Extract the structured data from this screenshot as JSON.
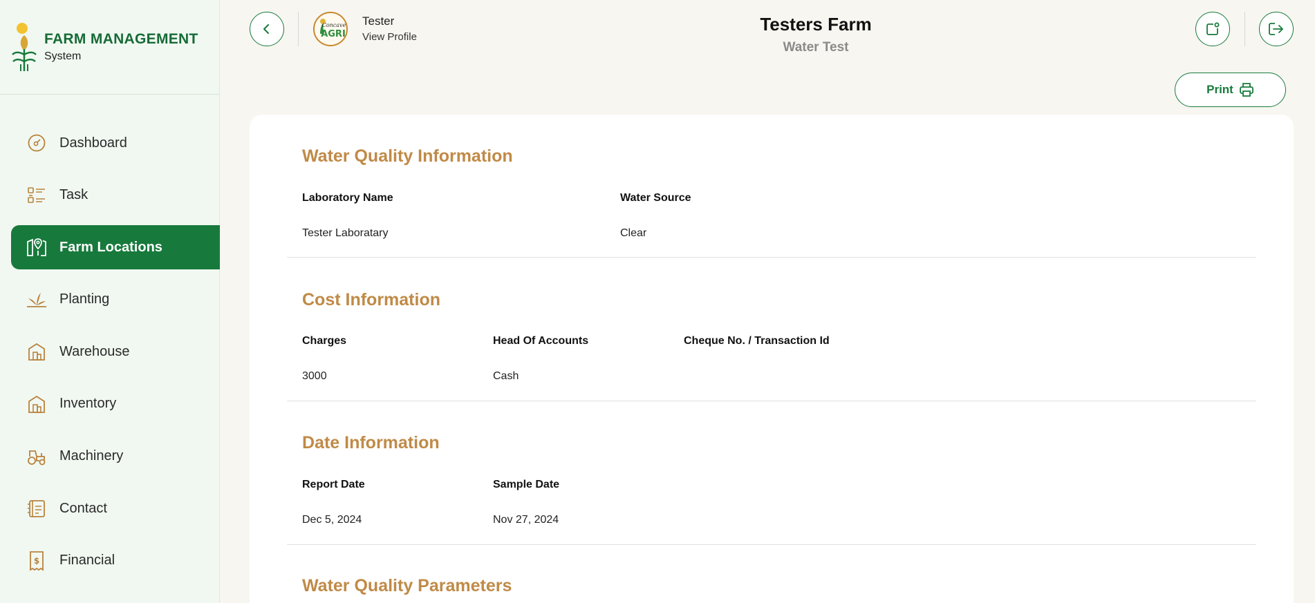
{
  "brand": {
    "title": "FARM MANAGEMENT",
    "subtitle": "System"
  },
  "sidebar": {
    "items": [
      {
        "label": "Dashboard",
        "icon": "dashboard-gauge-icon",
        "active": false
      },
      {
        "label": "Task",
        "icon": "task-list-icon",
        "active": false
      },
      {
        "label": "Farm Locations",
        "icon": "map-pin-icon",
        "active": true
      },
      {
        "label": "Planting",
        "icon": "plant-icon",
        "active": false
      },
      {
        "label": "Warehouse",
        "icon": "warehouse-icon",
        "active": false
      },
      {
        "label": "Inventory",
        "icon": "inventory-icon",
        "active": false
      },
      {
        "label": "Machinery",
        "icon": "tractor-icon",
        "active": false
      },
      {
        "label": "Contact",
        "icon": "contact-book-icon",
        "active": false
      },
      {
        "label": "Financial",
        "icon": "receipt-dollar-icon",
        "active": false
      }
    ]
  },
  "header": {
    "user_name": "Tester",
    "view_profile": "View Profile",
    "avatar_text_top": "Concave",
    "avatar_text_bottom": "AGRI",
    "title": "Testers Farm",
    "subtitle": "Water Test",
    "print_label": "Print"
  },
  "sections": {
    "water_quality": {
      "title": "Water Quality Information",
      "lab_label": "Laboratory Name",
      "lab_value": "Tester Laboratary",
      "source_label": "Water Source",
      "source_value": "Clear"
    },
    "cost": {
      "title": "Cost Information",
      "charges_label": "Charges",
      "charges_value": "3000",
      "head_label": "Head Of Accounts",
      "head_value": "Cash",
      "cheque_label": "Cheque No. / Transaction Id",
      "cheque_value": ""
    },
    "date": {
      "title": "Date Information",
      "report_label": "Report Date",
      "report_value": "Dec 5, 2024",
      "sample_label": "Sample Date",
      "sample_value": "Nov 27, 2024"
    },
    "parameters": {
      "title": "Water Quality Parameters"
    }
  },
  "colors": {
    "primary_green": "#177a3c",
    "section_title": "#c08a47",
    "icon_gold": "#b9823d",
    "sidebar_bg": "#f1f8f1"
  }
}
